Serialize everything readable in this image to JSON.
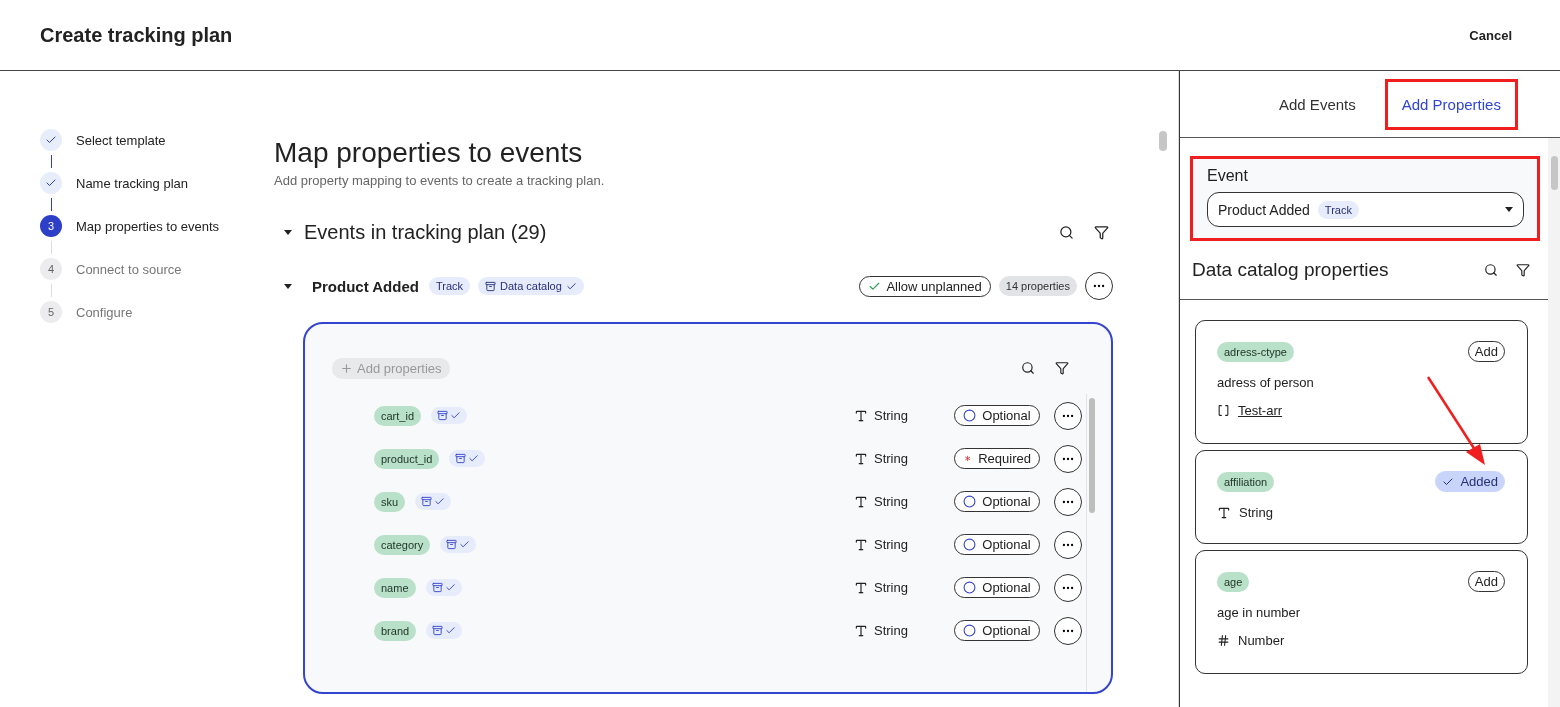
{
  "header": {
    "title": "Create tracking plan",
    "cancel": "Cancel"
  },
  "steps": [
    {
      "label": "Select template",
      "done": true
    },
    {
      "label": "Name tracking plan",
      "done": true
    },
    {
      "label": "Map properties to events",
      "done": false,
      "current": true,
      "number": "3"
    },
    {
      "label": "Connect to source",
      "done": false,
      "current": false,
      "number": "4"
    },
    {
      "label": "Configure",
      "done": false,
      "current": false,
      "number": "5"
    }
  ],
  "main": {
    "title": "Map properties to events",
    "subtitle": "Add property mapping to events to create a tracking plan.",
    "section_title": "Events in tracking plan (29)",
    "section_expanded": true
  },
  "event": {
    "name": "Product Added",
    "expanded": true,
    "type_tag": "Track",
    "catalog_label": "Data catalog",
    "allow_unplanned": {
      "label": "Allow unplanned",
      "checked": true
    },
    "properties_count": "14 properties",
    "add_properties": "Add properties",
    "properties": [
      {
        "name": "cart_id",
        "type": "String",
        "required": false,
        "requirement_label": "Optional"
      },
      {
        "name": "product_id",
        "type": "String",
        "required": true,
        "requirement_label": "Required"
      },
      {
        "name": "sku",
        "type": "String",
        "required": false,
        "requirement_label": "Optional"
      },
      {
        "name": "category",
        "type": "String",
        "required": false,
        "requirement_label": "Optional"
      },
      {
        "name": "name",
        "type": "String",
        "required": false,
        "requirement_label": "Optional"
      },
      {
        "name": "brand",
        "type": "String",
        "required": false,
        "requirement_label": "Optional"
      }
    ]
  },
  "panel": {
    "tabs": [
      {
        "label": "Add Events",
        "selected": false,
        "highlighted": false
      },
      {
        "label": "Add Properties",
        "selected": true,
        "highlighted": true
      }
    ],
    "event_field": {
      "label": "Event",
      "value": "Product Added",
      "tag": "Track",
      "highlighted": true
    },
    "catalog_title": "Data catalog properties",
    "cards": [
      {
        "tag": "adress-ctype",
        "added": false,
        "button": "Add",
        "pointed": false,
        "description": "adress of person",
        "type": {
          "kind": "array",
          "label": "Test-arr",
          "linked": true
        }
      },
      {
        "tag": "affiliation",
        "added": true,
        "button": "Added",
        "pointed": true,
        "type": {
          "kind": "string",
          "label": "String",
          "linked": false
        }
      },
      {
        "tag": "age",
        "added": false,
        "button": "Add",
        "pointed": false,
        "description": "age in number",
        "type": {
          "kind": "number",
          "label": "Number",
          "linked": false
        }
      }
    ]
  }
}
